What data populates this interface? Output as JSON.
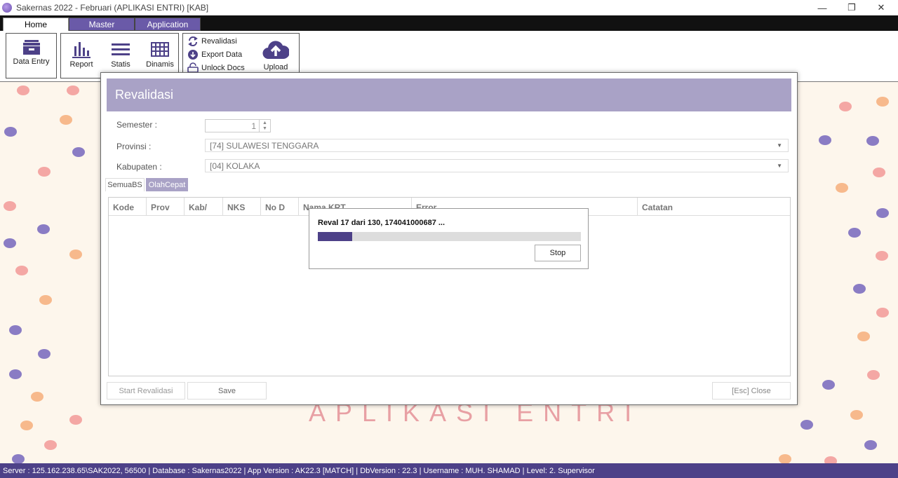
{
  "window": {
    "title": "Sakernas 2022 - Februari (APLIKASI ENTRI) [KAB]",
    "minimize": "—",
    "restore": "❐",
    "close": "✕"
  },
  "ribbon": {
    "tabs": [
      {
        "label": "Home"
      },
      {
        "label": "Master"
      },
      {
        "label": "Application"
      }
    ],
    "buttons": {
      "data_entry": "Data Entry",
      "report": "Report",
      "statis": "Statis",
      "dinamis": "Dinamis",
      "revalidasi": "Revalidasi",
      "export_data": "Export Data",
      "unlock_docs": "Unlock Docs",
      "upload": "Upload"
    },
    "icons": {
      "data_entry": "inbox-tray-icon",
      "report": "bar-chart-icon",
      "statis": "list-lines-icon",
      "dinamis": "table-grid-icon",
      "revalidasi": "refresh-arrows-icon",
      "export_data": "cloud-download-icon",
      "unlock_docs": "unlock-icon",
      "upload": "cloud-upload-icon"
    }
  },
  "background": {
    "watermark": "APLIKASI ENTRI"
  },
  "dialog": {
    "title": "Revalidasi",
    "semester_label": "Semester :",
    "semester_value": "1",
    "provinsi_label": "Provinsi :",
    "provinsi_value": "[74] SULAWESI TENGGARA",
    "kabupaten_label": "Kabupaten :",
    "kabupaten_value": "[04] KOLAKA",
    "tabs": [
      {
        "label": "SemuaBS"
      },
      {
        "label": "OlahCepat"
      }
    ],
    "columns": [
      "Kode",
      "Prov",
      "Kab/",
      "NKS",
      "No D",
      "Nama KRT",
      "Error",
      "Catatan"
    ],
    "start_button": "Start Revalidasi",
    "save_button": "Save",
    "close_button": "[Esc] Close"
  },
  "progress": {
    "message": "Reval 17 dari 130, 174041000687 ...",
    "fraction": 0.13,
    "stop_button": "Stop",
    "fill_color": "#4d4188"
  },
  "status": {
    "text": "Server : 125.162.238.65\\SAK2022, 56500 | Database : Sakernas2022  | App Version : AK22.3 [MATCH] | DbVersion : 22.3  | Username : MUH. SHAMAD | Level: 2. Supervisor"
  },
  "colors": {
    "accent": "#4d4188",
    "header": "#a9a2c6",
    "dot_pink": "#f4a7a4",
    "dot_orange": "#f7b98c",
    "dot_purple": "#8a7cc4"
  }
}
